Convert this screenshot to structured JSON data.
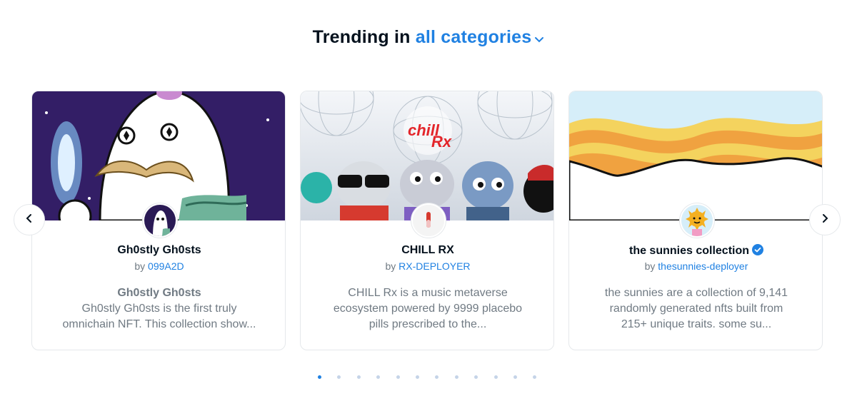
{
  "heading": {
    "prefix": "Trending in",
    "category": "all categories"
  },
  "nav": {
    "prev_icon": "chevron-left-icon",
    "next_icon": "chevron-right-icon"
  },
  "cards": [
    {
      "name": "Gh0stly Gh0sts",
      "by_prefix": "by",
      "creator": "099A2D",
      "desc_title": "Gh0stly Gh0sts",
      "desc": "Gh0stly Gh0sts is the first truly omnichain NFT. This collection show...",
      "verified": false
    },
    {
      "name": "CHILL RX",
      "by_prefix": "by",
      "creator": "RX-DEPLOYER",
      "desc": "CHILL Rx is a music metaverse ecosystem powered by 9999 placebo pills prescribed to the...",
      "verified": false,
      "banner_logo": "chill Rx"
    },
    {
      "name": "the sunnies collection",
      "by_prefix": "by",
      "creator": "thesunnies-deployer",
      "desc": "the sunnies are a collection of 9,141 randomly generated nfts built from 215+ unique traits. some su...",
      "verified": true
    }
  ],
  "pagination": {
    "total": 12,
    "active_index": 0
  },
  "colors": {
    "accent": "#2081e2",
    "text": "#04111d",
    "muted": "#707a83",
    "border": "#e5e8eb"
  }
}
